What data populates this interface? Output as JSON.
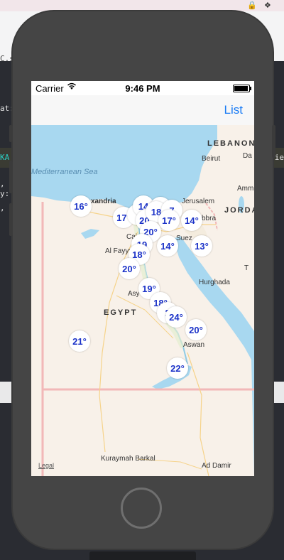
{
  "mac_bar": {
    "lock_icon": "lock-icon",
    "dropbox_icon": "dropbox-icon"
  },
  "editor": {
    "path_fragment": "C.sw",
    "lines_left": [
      "at:",
      ",",
      "y:",
      ","
    ],
    "line_hl_left": "KA",
    "line_hl_right": "ie"
  },
  "status_bar": {
    "carrier": "Carrier",
    "time": "9:46 PM",
    "battery_level": 0.95
  },
  "nav": {
    "right_label": "List"
  },
  "map": {
    "legal": "Legal",
    "labels": [
      {
        "id": "lebanon",
        "text": "LEBANON",
        "kind": "country"
      },
      {
        "id": "beirut",
        "text": "Beirut",
        "kind": "city"
      },
      {
        "id": "da",
        "text": "Da",
        "kind": "city"
      },
      {
        "id": "med-sea",
        "text": "Mediterranean Sea",
        "kind": "sea"
      },
      {
        "id": "amm",
        "text": "Amm",
        "kind": "city"
      },
      {
        "id": "jordan",
        "text": "JORDA",
        "kind": "country"
      },
      {
        "id": "alexandria",
        "text": "xandria",
        "kind": "city"
      },
      {
        "id": "jerusalem",
        "text": "Jerusalem",
        "kind": "city"
      },
      {
        "id": "aqaba",
        "text": "bbra",
        "kind": "city"
      },
      {
        "id": "cairo",
        "text": "Cai",
        "kind": "city"
      },
      {
        "id": "suez",
        "text": "Suez",
        "kind": "city"
      },
      {
        "id": "fayyum",
        "text": "Al Fayyu",
        "kind": "city"
      },
      {
        "id": "t",
        "text": "T",
        "kind": "city"
      },
      {
        "id": "asyut",
        "text": "Asy",
        "kind": "city"
      },
      {
        "id": "hurghada",
        "text": "Hurghada",
        "kind": "city"
      },
      {
        "id": "egypt",
        "text": "EGYPT",
        "kind": "country"
      },
      {
        "id": "aswan",
        "text": "Aswan",
        "kind": "city"
      },
      {
        "id": "kuraymah",
        "text": "Kuraymah Barkal",
        "kind": "city"
      },
      {
        "id": "addamir",
        "text": "Ad Damir",
        "kind": "city"
      }
    ],
    "pins": [
      {
        "id": "alexandria",
        "temp": "16°"
      },
      {
        "id": "p2",
        "temp": "17°"
      },
      {
        "id": "p3",
        "temp": "7"
      },
      {
        "id": "p4",
        "temp": "14"
      },
      {
        "id": "p5",
        "temp": "1"
      },
      {
        "id": "p6",
        "temp": "20°"
      },
      {
        "id": "p7",
        "temp": "18"
      },
      {
        "id": "p8",
        "temp": "7"
      },
      {
        "id": "p9",
        "temp": "17°"
      },
      {
        "id": "p10",
        "temp": "14°"
      },
      {
        "id": "p11",
        "temp": "20°"
      },
      {
        "id": "p12",
        "temp": "19"
      },
      {
        "id": "p13",
        "temp": "14°"
      },
      {
        "id": "p14",
        "temp": "13°"
      },
      {
        "id": "p15",
        "temp": "18°"
      },
      {
        "id": "p16",
        "temp": "20°"
      },
      {
        "id": "p17",
        "temp": "19°"
      },
      {
        "id": "p18",
        "temp": "18°"
      },
      {
        "id": "p19",
        "temp": "2"
      },
      {
        "id": "p20",
        "temp": "24°"
      },
      {
        "id": "p21",
        "temp": "20°"
      },
      {
        "id": "p22",
        "temp": "21°"
      },
      {
        "id": "p23",
        "temp": "22°"
      }
    ]
  }
}
